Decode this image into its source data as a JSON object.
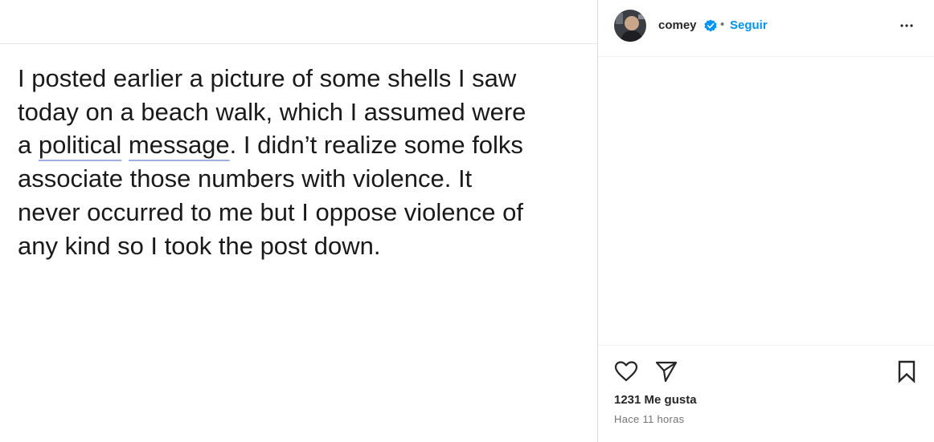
{
  "post": {
    "lines": [
      {
        "text": "I posted earlier a picture of some shells I saw"
      },
      {
        "text": "today on a beach walk, which I assumed were"
      },
      {
        "pre": "a ",
        "u1": "political",
        "mid": " ",
        "u2": "message",
        "post": ". I didn’t realize some folks"
      },
      {
        "text": "associate those numbers with violence. It"
      },
      {
        "text": "never occurred to me but I oppose violence of"
      },
      {
        "text": "any kind so I took the post down."
      }
    ]
  },
  "header": {
    "username": "comey",
    "separator": "•",
    "follow_label": "Seguir",
    "avatar_icon": "profile-photo",
    "verified_icon": "verified-badge-icon",
    "more_icon": "more-options-icon"
  },
  "actions": {
    "like_icon": "heart-icon",
    "share_icon": "paper-plane-icon",
    "save_icon": "bookmark-icon"
  },
  "stats": {
    "likes": "1231 Me gusta",
    "time": "Hace 11 horas"
  },
  "colors": {
    "follow": "#0095f6",
    "verified": "#0095f6",
    "muted": "#737373"
  }
}
